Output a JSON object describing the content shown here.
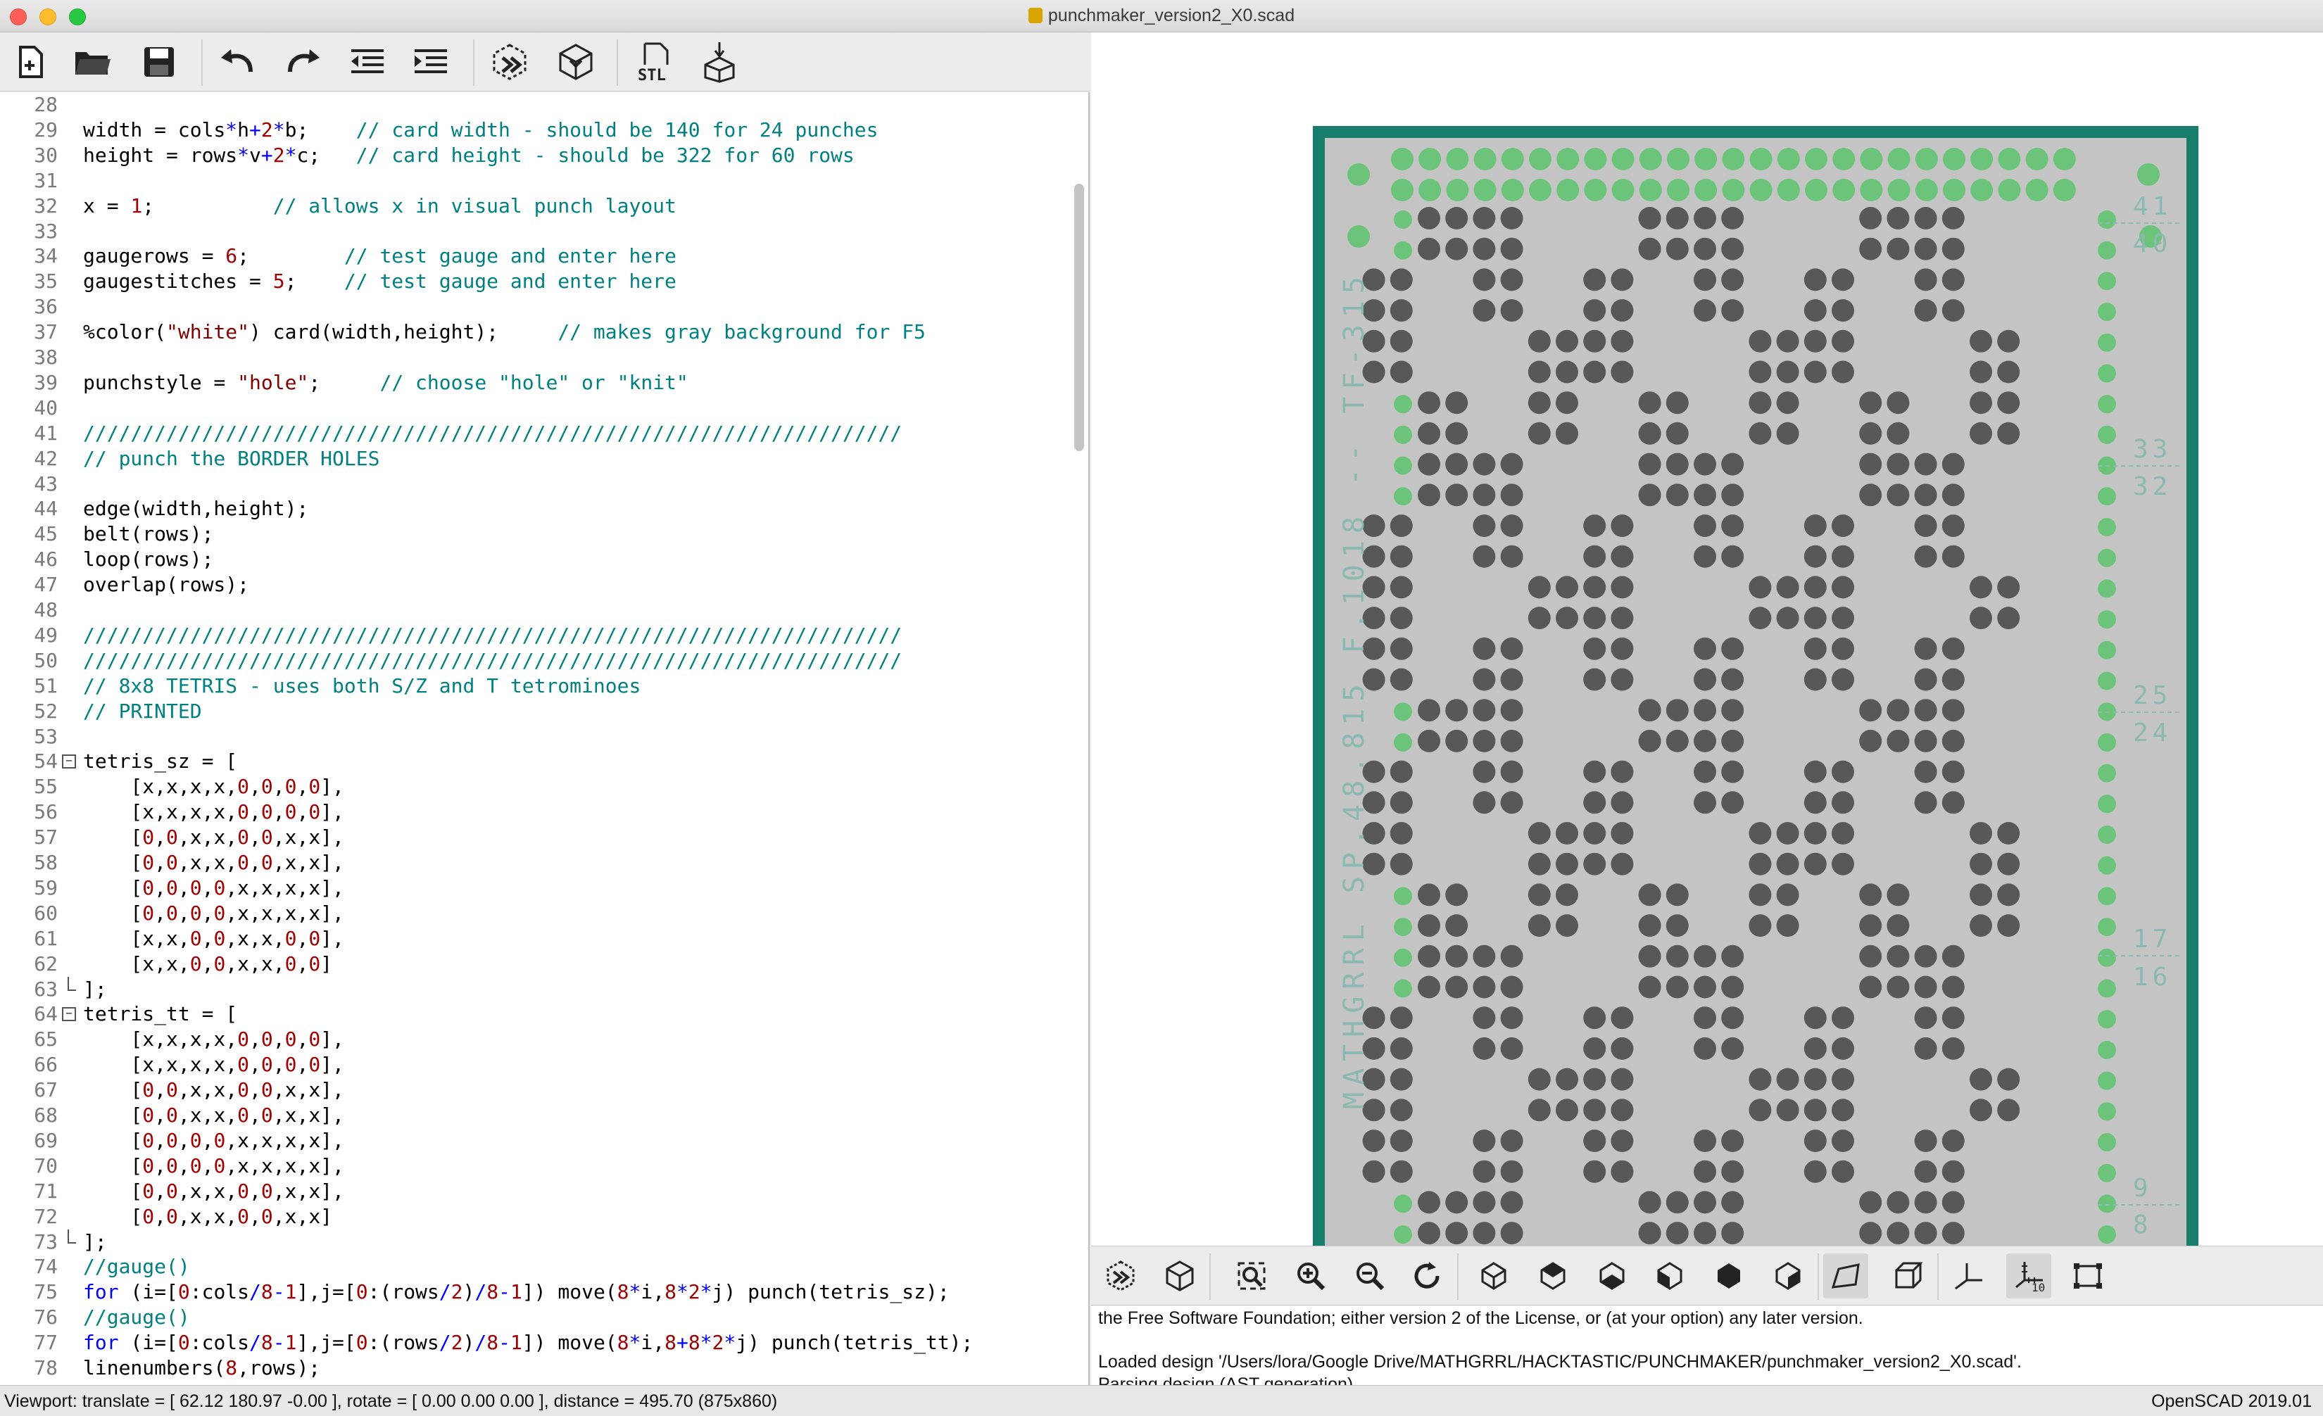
{
  "window": {
    "title": "punchmaker_version2_X0.scad"
  },
  "editor_toolbar": [
    {
      "name": "new-file-icon"
    },
    {
      "name": "open-folder-icon"
    },
    {
      "name": "save-icon"
    },
    {
      "name": "undo-icon"
    },
    {
      "name": "redo-icon"
    },
    {
      "name": "unindent-icon"
    },
    {
      "name": "indent-icon"
    },
    {
      "name": "preview-icon"
    },
    {
      "name": "render-icon"
    },
    {
      "name": "export-stl-icon",
      "label": "STL"
    },
    {
      "name": "send-to-print-icon"
    }
  ],
  "code_lines": [
    {
      "n": "28",
      "t": ""
    },
    {
      "n": "29",
      "t": "width = cols*h+2*b;    // card width - should be 140 for 24 punches"
    },
    {
      "n": "30",
      "t": "height = rows*v+2*c;   // card height - should be 322 for 60 rows"
    },
    {
      "n": "31",
      "t": ""
    },
    {
      "n": "32",
      "t": "x = 1;          // allows x in visual punch layout"
    },
    {
      "n": "33",
      "t": ""
    },
    {
      "n": "34",
      "t": "gaugerows = 6;        // test gauge and enter here"
    },
    {
      "n": "35",
      "t": "gaugestitches = 5;    // test gauge and enter here"
    },
    {
      "n": "36",
      "t": ""
    },
    {
      "n": "37",
      "t": "%color(\"white\") card(width,height);     // makes gray background for F5"
    },
    {
      "n": "38",
      "t": ""
    },
    {
      "n": "39",
      "t": "punchstyle = \"hole\";     // choose \"hole\" or \"knit\""
    },
    {
      "n": "40",
      "t": ""
    },
    {
      "n": "41",
      "t": "/////////////////////////////////////////////////////////////////////"
    },
    {
      "n": "42",
      "t": "// punch the BORDER HOLES"
    },
    {
      "n": "43",
      "t": ""
    },
    {
      "n": "44",
      "t": "edge(width,height);"
    },
    {
      "n": "45",
      "t": "belt(rows);"
    },
    {
      "n": "46",
      "t": "loop(rows);"
    },
    {
      "n": "47",
      "t": "overlap(rows);"
    },
    {
      "n": "48",
      "t": ""
    },
    {
      "n": "49",
      "t": "/////////////////////////////////////////////////////////////////////"
    },
    {
      "n": "50",
      "t": "/////////////////////////////////////////////////////////////////////"
    },
    {
      "n": "51",
      "t": "// 8x8 TETRIS - uses both S/Z and T tetrominoes"
    },
    {
      "n": "52",
      "t": "// PRINTED"
    },
    {
      "n": "53",
      "t": ""
    },
    {
      "n": "54",
      "t": "tetris_sz = [",
      "fold": "open"
    },
    {
      "n": "55",
      "t": "    [x,x,x,x,0,0,0,0],"
    },
    {
      "n": "56",
      "t": "    [x,x,x,x,0,0,0,0],"
    },
    {
      "n": "57",
      "t": "    [0,0,x,x,0,0,x,x],"
    },
    {
      "n": "58",
      "t": "    [0,0,x,x,0,0,x,x],"
    },
    {
      "n": "59",
      "t": "    [0,0,0,0,x,x,x,x],"
    },
    {
      "n": "60",
      "t": "    [0,0,0,0,x,x,x,x],"
    },
    {
      "n": "61",
      "t": "    [x,x,0,0,x,x,0,0],"
    },
    {
      "n": "62",
      "t": "    [x,x,0,0,x,x,0,0]"
    },
    {
      "n": "63",
      "t": "];",
      "fold": "end"
    },
    {
      "n": "64",
      "t": "tetris_tt = [",
      "fold": "open"
    },
    {
      "n": "65",
      "t": "    [x,x,x,x,0,0,0,0],"
    },
    {
      "n": "66",
      "t": "    [x,x,x,x,0,0,0,0],"
    },
    {
      "n": "67",
      "t": "    [0,0,x,x,0,0,x,x],"
    },
    {
      "n": "68",
      "t": "    [0,0,x,x,0,0,x,x],"
    },
    {
      "n": "69",
      "t": "    [0,0,0,0,x,x,x,x],"
    },
    {
      "n": "70",
      "t": "    [0,0,0,0,x,x,x,x],"
    },
    {
      "n": "71",
      "t": "    [0,0,x,x,0,0,x,x],"
    },
    {
      "n": "72",
      "t": "    [0,0,x,x,0,0,x,x]"
    },
    {
      "n": "73",
      "t": "];",
      "fold": "end"
    },
    {
      "n": "74",
      "t": "//gauge()"
    },
    {
      "n": "75",
      "t": "for (i=[0:cols/8-1],j=[0:(rows/2)/8-1]) move(8*i,8*2*j) punch(tetris_sz);"
    },
    {
      "n": "76",
      "t": "//gauge()"
    },
    {
      "n": "77",
      "t": "for (i=[0:cols/8-1],j=[0:(rows/2)/8-1]) move(8*i,8+8*2*j) punch(tetris_tt);"
    },
    {
      "n": "78",
      "t": "linenumbers(8,rows);"
    }
  ],
  "card": {
    "vertical_label": "MATHGRRL SP.48.815 F.1018 -- TF-315",
    "row_labels": [
      "41",
      "40",
      "33",
      "32",
      "25",
      "24",
      "17",
      "16",
      "9",
      "8"
    ],
    "pattern_pair": [
      "tetris_sz",
      "tetris_tt"
    ]
  },
  "view_toolbar": [
    {
      "name": "preview-icon"
    },
    {
      "name": "render-icon"
    },
    {
      "name": "view-all-icon"
    },
    {
      "name": "zoom-in-icon"
    },
    {
      "name": "zoom-out-icon"
    },
    {
      "name": "reset-view-icon"
    },
    {
      "name": "view-right-icon"
    },
    {
      "name": "view-top-icon"
    },
    {
      "name": "view-bottom-icon"
    },
    {
      "name": "view-left-icon"
    },
    {
      "name": "view-front-icon"
    },
    {
      "name": "view-back-icon"
    },
    {
      "name": "perspective-icon"
    },
    {
      "name": "orthogonal-icon"
    },
    {
      "name": "show-axes-icon"
    },
    {
      "name": "show-scale-markers-icon",
      "label": "10"
    },
    {
      "name": "show-edges-icon"
    }
  ],
  "console": {
    "lines": [
      "the Free Software Foundation; either version 2 of the License, or (at your option) any later version.",
      "",
      "Loaded design '/Users/lora/Google Drive/MATHGRRL/HACKTASTIC/PUNCHMAKER/punchmaker_version2_X0.scad'.",
      "Parsing design (AST generation)..."
    ]
  },
  "status": {
    "viewport": "Viewport: translate = [ 62.12 180.97 -0.00 ], rotate = [ 0.00 0.00 0.00 ], distance = 495.70 (875x860)",
    "version": "OpenSCAD 2019.01"
  },
  "colors": {
    "card_gray": "#c4c4c4",
    "card_border": "#177e6c",
    "hole_dark": "#585858",
    "hole_green": "#6cc47a",
    "code_keyword": "#0000ff",
    "code_comment": "#008080",
    "code_string": "#800000",
    "code_number": "#a00000"
  }
}
